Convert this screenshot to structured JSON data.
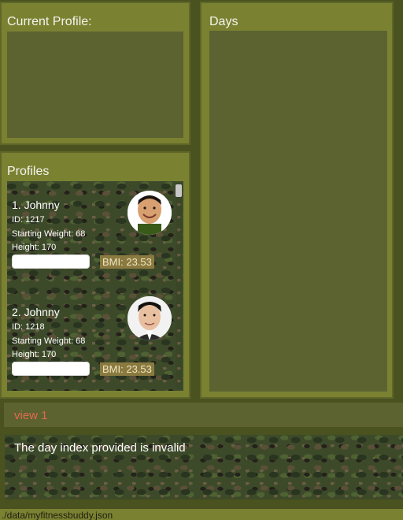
{
  "current_profile": {
    "title": "Current Profile:"
  },
  "days": {
    "title": "Days"
  },
  "profiles": {
    "title": "Profiles",
    "items": [
      {
        "name": "1.  Johnny",
        "id": "ID: 1217",
        "starting_weight": "Starting Weight: 68",
        "height": "Height: 170",
        "bmi": "BMI: 23.53",
        "avatar": "profile-photo-1"
      },
      {
        "name": "2.  Johnny",
        "id": "ID: 1218",
        "starting_weight": "Starting Weight: 68",
        "height": "Height: 170",
        "bmi": "BMI: 23.53",
        "avatar": "profile-photo-2"
      }
    ]
  },
  "command": {
    "text": "view 1"
  },
  "result": {
    "text": "The day index provided is invalid"
  },
  "status_bar": {
    "path": "./data/myfitnessbuddy.json"
  },
  "colors": {
    "panel": "#7a8232",
    "panel_inner": "#5c6330",
    "command_text": "#e06a50",
    "bmi_badge": "#8a7a40"
  }
}
